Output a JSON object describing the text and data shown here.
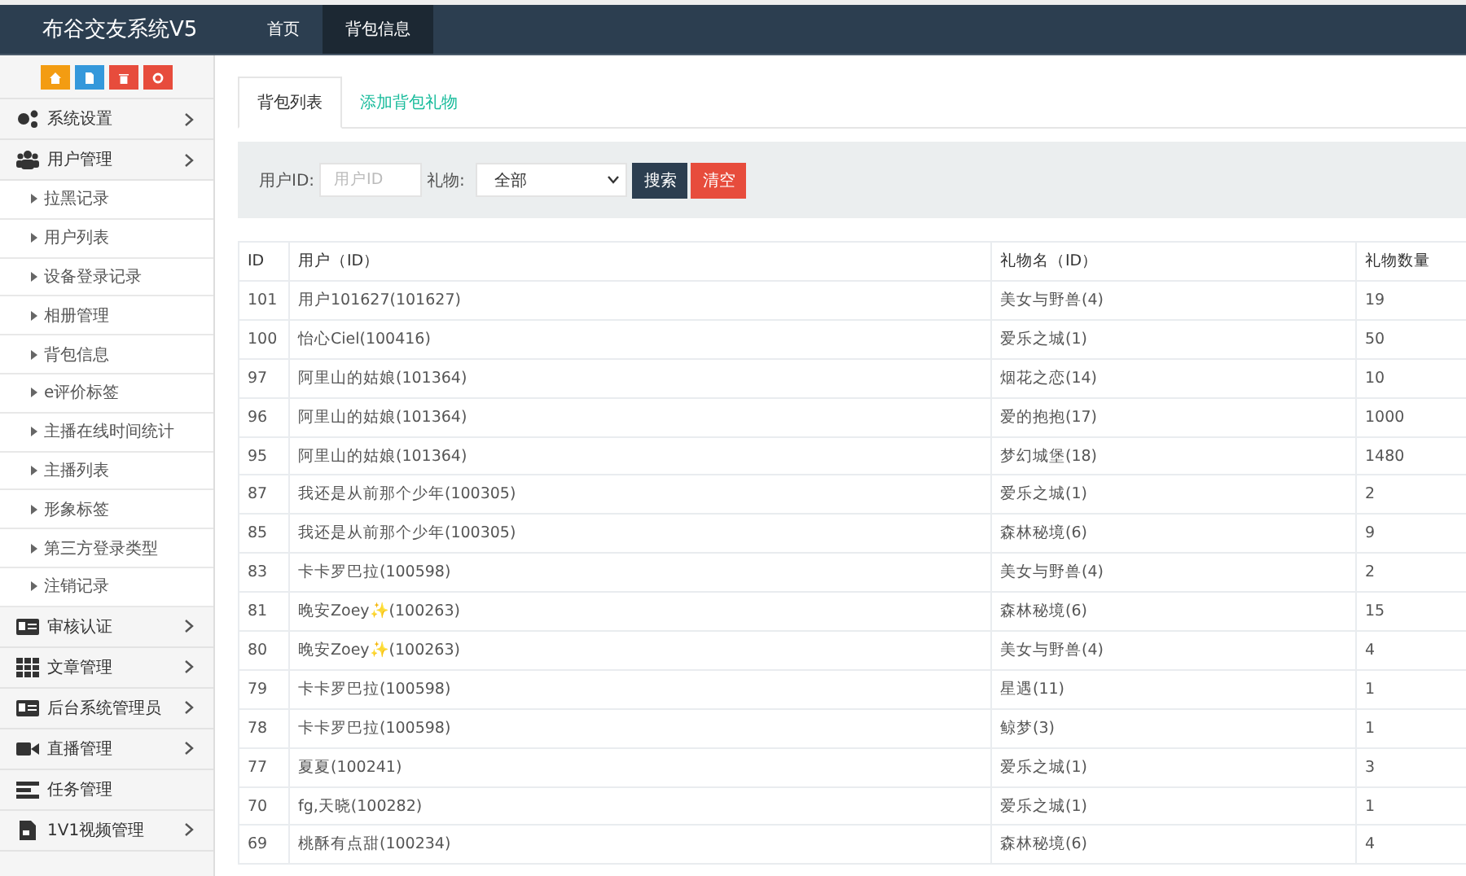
{
  "brand": "布谷交友系统V5",
  "nav": [
    {
      "label": "首页",
      "selected": false
    },
    {
      "label": "背包信息",
      "selected": true
    }
  ],
  "sidebar": {
    "items": [
      {
        "label": "系统设置",
        "chevron": true
      },
      {
        "label": "用户管理",
        "chevron": true,
        "children": [
          {
            "label": "拉黑记录"
          },
          {
            "label": "用户列表"
          },
          {
            "label": "设备登录记录"
          },
          {
            "label": "相册管理"
          },
          {
            "label": "背包信息"
          },
          {
            "label": "e评价标签"
          },
          {
            "label": "主播在线时间统计"
          },
          {
            "label": "主播列表"
          },
          {
            "label": "形象标签"
          },
          {
            "label": "第三方登录类型"
          },
          {
            "label": "注销记录"
          }
        ]
      },
      {
        "label": "审核认证",
        "chevron": true
      },
      {
        "label": "文章管理",
        "chevron": true
      },
      {
        "label": "后台系统管理员",
        "chevron": true
      },
      {
        "label": "直播管理",
        "chevron": true
      },
      {
        "label": "任务管理",
        "chevron": false
      },
      {
        "label": "1V1视频管理",
        "chevron": true
      }
    ]
  },
  "tabs": [
    {
      "label": "背包列表",
      "selected": true
    },
    {
      "label": "添加背包礼物",
      "selected": false
    }
  ],
  "filter": {
    "user_label": "用户ID:",
    "user_placeholder": "用户ID",
    "gift_label": "礼物:",
    "gift_value": "全部",
    "search_button": "搜索",
    "clear_button": "清空"
  },
  "table": {
    "columns": [
      "ID",
      "用户（ID）",
      "礼物名（ID）",
      "礼物数量"
    ],
    "rows": [
      [
        "101",
        "用户101627(101627)",
        "美女与野兽(4)",
        "19"
      ],
      [
        "100",
        "怡心Ciel(100416)",
        "爱乐之城(1)",
        "50"
      ],
      [
        "97",
        "阿里山的姑娘(101364)",
        "烟花之恋(14)",
        "10"
      ],
      [
        "96",
        "阿里山的姑娘(101364)",
        "爱的抱抱(17)",
        "1000"
      ],
      [
        "95",
        "阿里山的姑娘(101364)",
        "梦幻城堡(18)",
        "1480"
      ],
      [
        "87",
        "我还是从前那个少年(100305)",
        "爱乐之城(1)",
        "2"
      ],
      [
        "85",
        "我还是从前那个少年(100305)",
        "森林秘境(6)",
        "9"
      ],
      [
        "83",
        "卡卡罗巴拉(100598)",
        "美女与野兽(4)",
        "2"
      ],
      [
        "81",
        "晚安Zoey✨(100263)",
        "森林秘境(6)",
        "15"
      ],
      [
        "80",
        "晚安Zoey✨(100263)",
        "美女与野兽(4)",
        "4"
      ],
      [
        "79",
        "卡卡罗巴拉(100598)",
        "星遇(11)",
        "1"
      ],
      [
        "78",
        "卡卡罗巴拉(100598)",
        "鲸梦(3)",
        "1"
      ],
      [
        "77",
        "夏夏(100241)",
        "爱乐之城(1)",
        "3"
      ],
      [
        "70",
        "fg,天晓(100282)",
        "爱乐之城(1)",
        "1"
      ],
      [
        "69",
        "桃酥有点甜(100234)",
        "森林秘境(6)",
        "4"
      ]
    ]
  }
}
